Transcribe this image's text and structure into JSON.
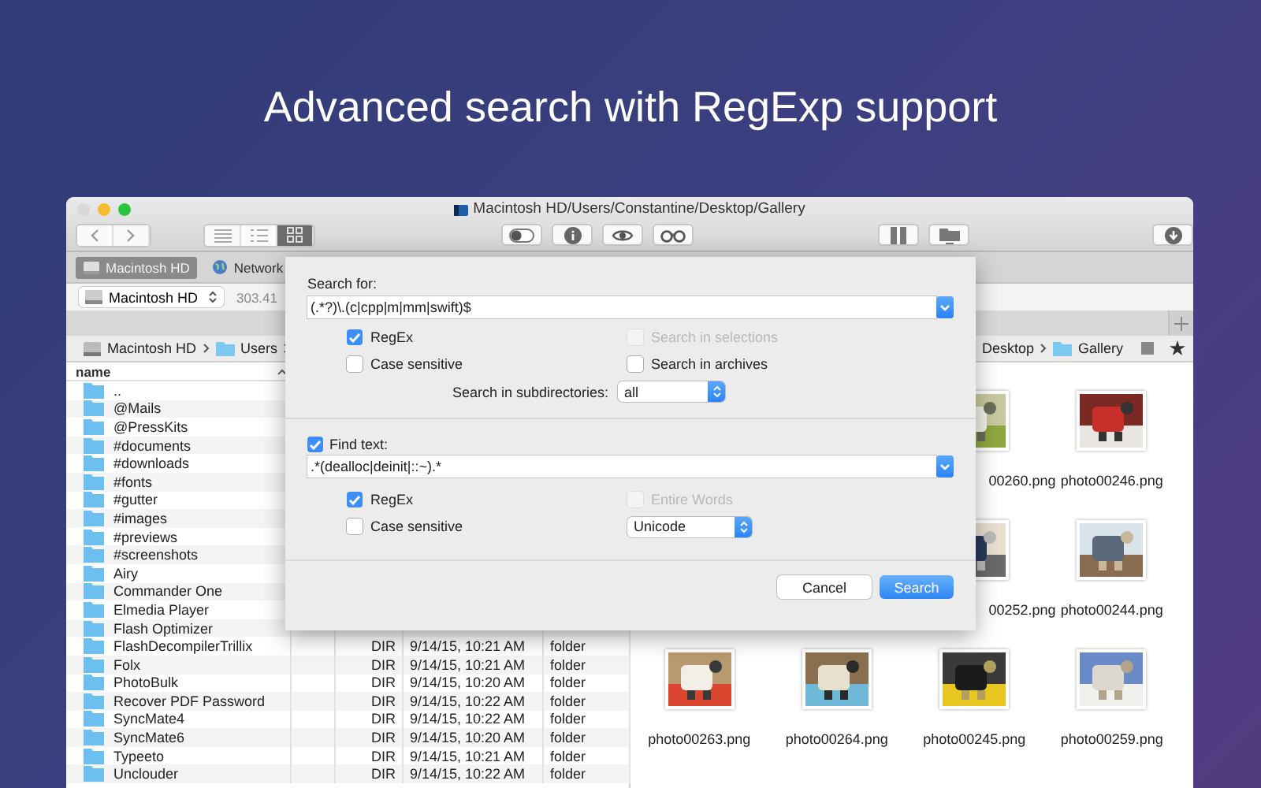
{
  "headline": "Advanced search with RegExp support",
  "window": {
    "title": "Macintosh HD/Users/Constantine/Desktop/Gallery",
    "view_modes": [
      {
        "kind": "list",
        "selected": false
      },
      {
        "kind": "details",
        "selected": false
      },
      {
        "kind": "grid",
        "selected": true
      }
    ]
  },
  "tabs": [
    {
      "label": "Macintosh HD",
      "selected": true
    },
    {
      "label": "Network",
      "selected": false
    }
  ],
  "drive": {
    "name": "Macintosh HD",
    "free": "303.41"
  },
  "left_pane": {
    "path": [
      "Macintosh HD",
      "Users"
    ],
    "column": "name",
    "rows": [
      {
        "name": ".."
      },
      {
        "name": "@Mails"
      },
      {
        "name": "@PressKits"
      },
      {
        "name": "#documents"
      },
      {
        "name": "#downloads"
      },
      {
        "name": "#fonts"
      },
      {
        "name": "#gutter"
      },
      {
        "name": "#images"
      },
      {
        "name": "#previews"
      },
      {
        "name": "#screenshots"
      },
      {
        "name": "Airy"
      },
      {
        "name": "Commander One"
      },
      {
        "name": "Elmedia Player"
      },
      {
        "name": "Flash Optimizer"
      },
      {
        "name": "FlashDecompilerTrillix",
        "size": "DIR",
        "date": "9/14/15, 10:21 AM",
        "kind": "folder"
      },
      {
        "name": "Folx",
        "size": "DIR",
        "date": "9/14/15, 10:21 AM",
        "kind": "folder"
      },
      {
        "name": "PhotoBulk",
        "size": "DIR",
        "date": "9/14/15, 10:20 AM",
        "kind": "folder"
      },
      {
        "name": "Recover PDF Password",
        "size": "DIR",
        "date": "9/14/15, 10:22 AM",
        "kind": "folder"
      },
      {
        "name": "SyncMate4",
        "size": "DIR",
        "date": "9/14/15, 10:22 AM",
        "kind": "folder"
      },
      {
        "name": "SyncMate6",
        "size": "DIR",
        "date": "9/14/15, 10:20 AM",
        "kind": "folder"
      },
      {
        "name": "Typeeto",
        "size": "DIR",
        "date": "9/14/15, 10:21 AM",
        "kind": "folder"
      },
      {
        "name": "Unclouder",
        "size": "DIR",
        "date": "9/14/15, 10:22 AM",
        "kind": "folder"
      }
    ]
  },
  "right_pane": {
    "path": [
      "Desktop",
      "Gallery"
    ],
    "items": [
      {
        "name": "00260.png"
      },
      {
        "name": "photo00246.png"
      },
      {
        "name": "00252.png"
      },
      {
        "name": "photo00244.png"
      },
      {
        "name": "photo00263.png"
      },
      {
        "name": "photo00264.png"
      },
      {
        "name": "photo00245.png"
      },
      {
        "name": "photo00259.png"
      }
    ]
  },
  "dialog": {
    "search_label": "Search for:",
    "search_value": "(.*?)\\.(c|cpp|m|mm|swift)$",
    "search_options": [
      {
        "label": "RegEx",
        "checked": true,
        "disabled": false
      },
      {
        "label": "Search in selections",
        "checked": false,
        "disabled": true
      },
      {
        "label": "Case sensitive",
        "checked": false,
        "disabled": false
      },
      {
        "label": "Search in archives",
        "checked": false,
        "disabled": false
      }
    ],
    "subdirs_label": "Search in subdirectories:",
    "subdirs_value": "all",
    "find_text": {
      "label": "Find text:",
      "checked": true
    },
    "find_value": ".*(dealloc|deinit|::~).*",
    "find_options": [
      {
        "label": "RegEx",
        "checked": true,
        "disabled": false
      },
      {
        "label": "Entire Words",
        "checked": false,
        "disabled": true
      },
      {
        "label": "Case sensitive",
        "checked": false,
        "disabled": false
      }
    ],
    "encoding": "Unicode",
    "buttons": [
      {
        "label": "Cancel",
        "kind": "secondary"
      },
      {
        "label": "Search",
        "kind": "default"
      }
    ]
  }
}
